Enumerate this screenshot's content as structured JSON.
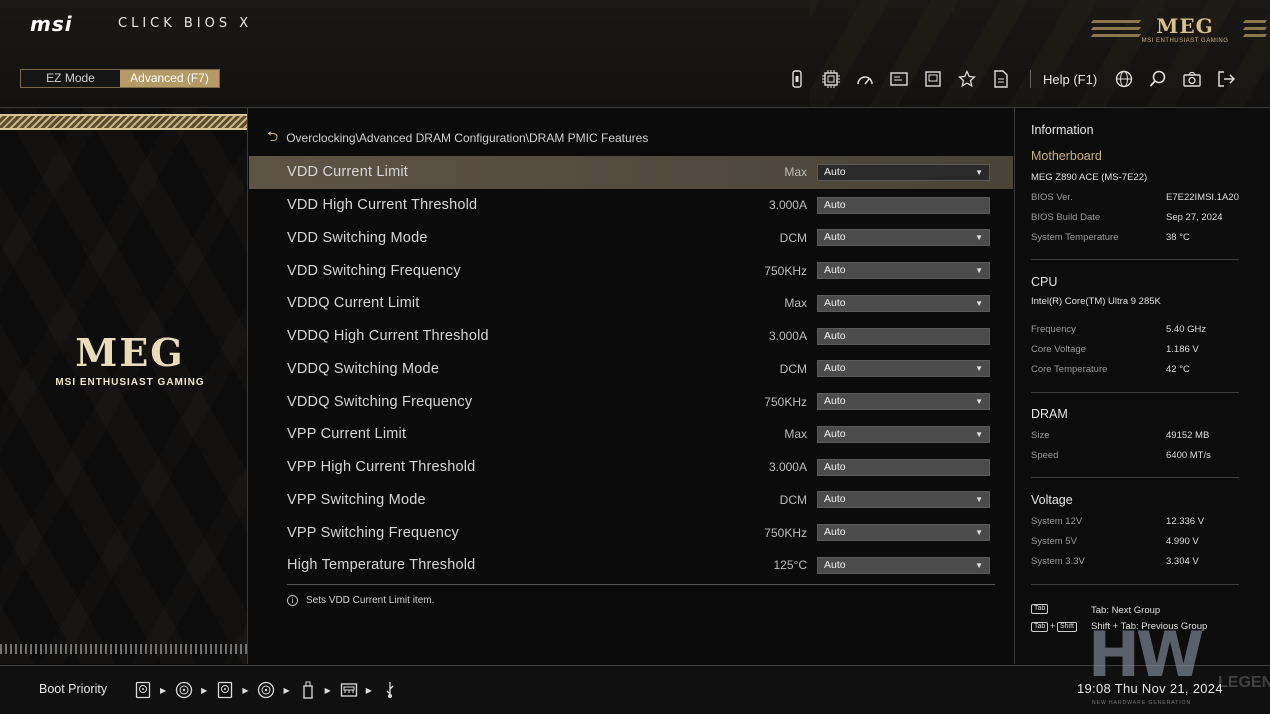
{
  "header": {
    "brand": "msi",
    "product": "CLICK BIOS X",
    "meg_logo": "MEG",
    "meg_tagline": "MSI ENTHUSIAST GAMING",
    "modes": [
      {
        "label": "EZ Mode",
        "active": false
      },
      {
        "label": "Advanced (F7)",
        "active": true
      }
    ],
    "help_label": "Help (F1)",
    "toolbar_icons": [
      "memory-stick-icon",
      "cpu-icon",
      "gauge-icon",
      "display-icon",
      "monitor-icon",
      "star-icon",
      "document-icon",
      "globe-icon",
      "search-icon",
      "camera-icon",
      "exit-icon"
    ]
  },
  "left_panel": {
    "logo_text": "MEG",
    "tagline": "MSI ENTHUSIAST GAMING"
  },
  "main": {
    "breadcrumb": "Overclocking\\Advanced DRAM Configuration\\DRAM PMIC Features",
    "rows": [
      {
        "name": "VDD Current Limit",
        "value": "Max",
        "control": "Auto",
        "dropdown": true,
        "selected": true
      },
      {
        "name": "VDD High Current Threshold",
        "value": "3.000A",
        "control": "Auto",
        "dropdown": false,
        "selected": false
      },
      {
        "name": "VDD Switching Mode",
        "value": "DCM",
        "control": "Auto",
        "dropdown": true,
        "selected": false
      },
      {
        "name": "VDD Switching Frequency",
        "value": "750KHz",
        "control": "Auto",
        "dropdown": true,
        "selected": false
      },
      {
        "name": "VDDQ Current Limit",
        "value": "Max",
        "control": "Auto",
        "dropdown": true,
        "selected": false
      },
      {
        "name": "VDDQ High Current Threshold",
        "value": "3.000A",
        "control": "Auto",
        "dropdown": false,
        "selected": false
      },
      {
        "name": "VDDQ Switching Mode",
        "value": "DCM",
        "control": "Auto",
        "dropdown": true,
        "selected": false
      },
      {
        "name": "VDDQ Switching Frequency",
        "value": "750KHz",
        "control": "Auto",
        "dropdown": true,
        "selected": false
      },
      {
        "name": "VPP Current Limit",
        "value": "Max",
        "control": "Auto",
        "dropdown": true,
        "selected": false
      },
      {
        "name": "VPP High Current Threshold",
        "value": "3.000A",
        "control": "Auto",
        "dropdown": false,
        "selected": false
      },
      {
        "name": "VPP Switching Mode",
        "value": "DCM",
        "control": "Auto",
        "dropdown": true,
        "selected": false
      },
      {
        "name": "VPP Switching Frequency",
        "value": "750KHz",
        "control": "Auto",
        "dropdown": true,
        "selected": false
      },
      {
        "name": "High Temperature Threshold",
        "value": "125°C",
        "control": "Auto",
        "dropdown": true,
        "selected": false
      }
    ],
    "hint": "Sets VDD Current Limit item."
  },
  "info": {
    "title": "Information",
    "motherboard": {
      "heading": "Motherboard",
      "model": "MEG Z890 ACE (MS-7E22)",
      "items": [
        {
          "k": "BIOS Ver.",
          "v": "E7E22IMSI.1A20"
        },
        {
          "k": "BIOS Build Date",
          "v": "Sep 27, 2024"
        },
        {
          "k": "System Temperature",
          "v": "38 °C"
        }
      ]
    },
    "cpu": {
      "heading": "CPU",
      "model": "Intel(R) Core(TM) Ultra 9 285K",
      "items": [
        {
          "k": "Frequency",
          "v": "5.40 GHz"
        },
        {
          "k": "Core Voltage",
          "v": "1.186 V"
        },
        {
          "k": "Core Temperature",
          "v": "42 °C"
        }
      ]
    },
    "dram": {
      "heading": "DRAM",
      "items": [
        {
          "k": "Size",
          "v": "49152 MB"
        },
        {
          "k": "Speed",
          "v": "6400 MT/s"
        }
      ]
    },
    "voltage": {
      "heading": "Voltage",
      "items": [
        {
          "k": "System 12V",
          "v": "12.336 V"
        },
        {
          "k": "System 5V",
          "v": "4.990 V"
        },
        {
          "k": "System 3.3V",
          "v": "3.304 V"
        }
      ]
    },
    "keys": [
      {
        "keys": [
          "Tab"
        ],
        "text": "Tab: Next Group"
      },
      {
        "keys": [
          "Tab",
          "Shift"
        ],
        "text": "Shift + Tab: Previous Group"
      }
    ]
  },
  "footer": {
    "boot_label": "Boot Priority",
    "boot_devices": [
      "disk-icon",
      "optical-disc-icon",
      "disk-icon",
      "optical-disc-icon",
      "usb-icon",
      "network-icon",
      "usb-icon"
    ],
    "clock": "19:08  Thu Nov 21, 2024",
    "watermark_main": "HW",
    "watermark_legend": "LEGEND",
    "watermark_sub": "NEW HARDWARE GENERATION"
  },
  "colors": {
    "accent_gold": "#c9b27a",
    "selected_row": "#5d5446",
    "active_mode": "#b39a66",
    "control_bg": "#4b4b4b"
  }
}
